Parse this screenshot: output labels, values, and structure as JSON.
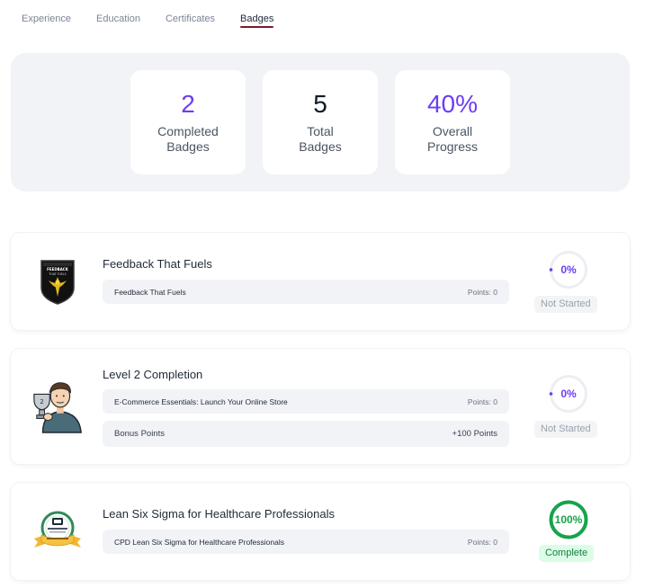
{
  "tabs": [
    {
      "label": "Experience"
    },
    {
      "label": "Education"
    },
    {
      "label": "Certificates"
    },
    {
      "label": "Badges"
    }
  ],
  "stats": {
    "completed": {
      "value": "2",
      "label": "Completed\nBadges"
    },
    "total": {
      "value": "5",
      "label": "Total\nBadges"
    },
    "overall": {
      "value": "40%",
      "label": "Overall\nProgress"
    }
  },
  "badges": [
    {
      "title": "Feedback That Fuels",
      "logo_text_1": "FEEDBACK",
      "logo_text_2": "THAT FUELS",
      "rows": [
        {
          "name": "Feedback That Fuels",
          "points": "Points: 0"
        }
      ],
      "progress": {
        "percent": 0,
        "label": "0%"
      },
      "status": "Not Started"
    },
    {
      "title": "Level 2 Completion",
      "rows": [
        {
          "name": "E-Commerce Essentials: Launch Your Online Store",
          "points": "Points: 0"
        },
        {
          "name": "Bonus Points",
          "points": "+100 Points"
        }
      ],
      "progress": {
        "percent": 0,
        "label": "0%"
      },
      "status": "Not Started"
    },
    {
      "title": "Lean Six Sigma for Healthcare Professionals",
      "rows": [
        {
          "name": "CPD Lean Six Sigma for Healthcare Professionals",
          "points": "Points: 0"
        }
      ],
      "progress": {
        "percent": 100,
        "label": "100%"
      },
      "status": "Complete"
    }
  ],
  "colors": {
    "accent": "#6d3df5",
    "tab_underline": "#7a1b2e",
    "complete_green": "#16a34a",
    "panel_bg": "#f2f3f7"
  },
  "icons": [
    "shield-badge-icon",
    "trophy-person-icon",
    "cpd-seal-icon"
  ]
}
